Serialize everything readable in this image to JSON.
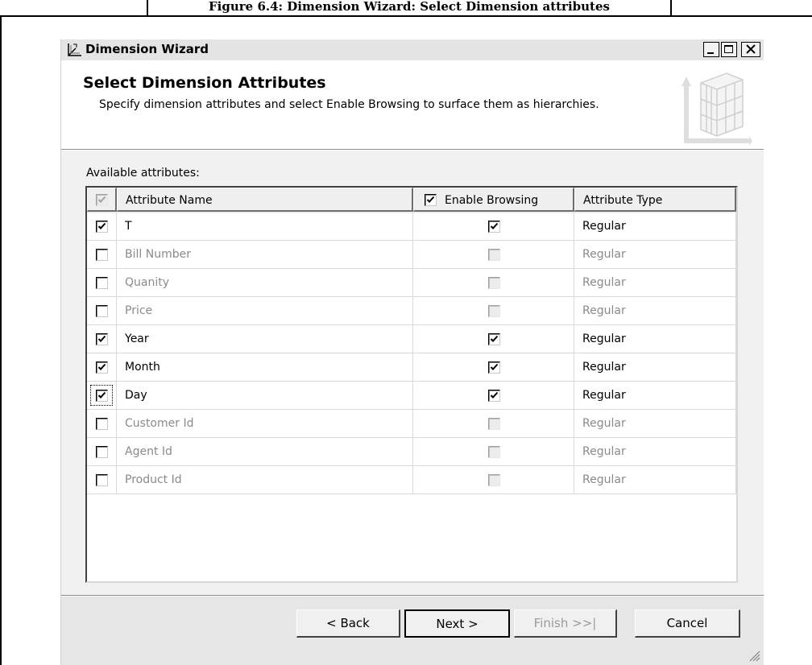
{
  "figure": {
    "caption": "Figure 6.4: Dimension Wizard: Select Dimension attributes"
  },
  "window": {
    "title": "Dimension Wizard",
    "icons": {
      "app": "dimension-wizard-icon",
      "minimize": "minimize-icon",
      "maximize": "maximize-icon",
      "close": "close-icon"
    }
  },
  "header": {
    "title": "Select Dimension Attributes",
    "description": "Specify dimension attributes and select Enable Browsing to surface them as hierarchies.",
    "graphic": "cube-grid-icon"
  },
  "attributes": {
    "label": "Available attributes:",
    "columns": {
      "select_all_checked": true,
      "name": "Attribute Name",
      "enable_browsing": "Enable Browsing",
      "enable_browsing_checked": true,
      "type": "Attribute Type"
    },
    "rows": [
      {
        "checked": true,
        "name": "T",
        "browsing": true,
        "type": "Regular"
      },
      {
        "checked": false,
        "name": "Bill Number",
        "browsing": false,
        "type": "Regular"
      },
      {
        "checked": false,
        "name": "Quanity",
        "browsing": false,
        "type": "Regular"
      },
      {
        "checked": false,
        "name": "Price",
        "browsing": false,
        "type": "Regular"
      },
      {
        "checked": true,
        "name": "Year",
        "browsing": true,
        "type": "Regular"
      },
      {
        "checked": true,
        "name": "Month",
        "browsing": true,
        "type": "Regular"
      },
      {
        "checked": true,
        "name": "Day",
        "browsing": true,
        "type": "Regular",
        "focused": true
      },
      {
        "checked": false,
        "name": "Customer Id",
        "browsing": false,
        "type": "Regular"
      },
      {
        "checked": false,
        "name": "Agent Id",
        "browsing": false,
        "type": "Regular"
      },
      {
        "checked": false,
        "name": "Product Id",
        "browsing": false,
        "type": "Regular"
      }
    ]
  },
  "buttons": {
    "back": "< Back",
    "next": "Next >",
    "finish": "Finish >>|",
    "cancel": "Cancel"
  }
}
